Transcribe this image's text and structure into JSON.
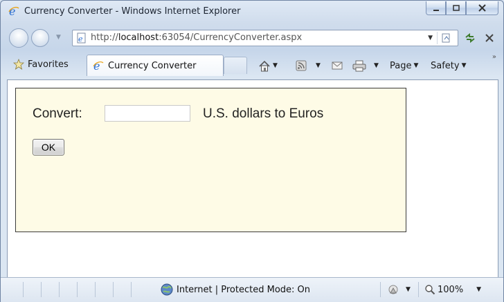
{
  "window": {
    "title": "Currency Converter - Windows Internet Explorer"
  },
  "navigation": {
    "url_host_prefix": "http://",
    "url_host": "localhost",
    "url_rest": ":63054/CurrencyConverter.aspx"
  },
  "commandbar": {
    "favorites_label": "Favorites",
    "tab_label": "Currency Converter",
    "page_label": "Page",
    "safety_label": "Safety"
  },
  "form": {
    "convert_label": "Convert:",
    "amount_value": "",
    "units_label": "U.S. dollars to Euros",
    "ok_label": "OK"
  },
  "statusbar": {
    "zone_text": "Internet | Protected Mode: On",
    "zoom_text": "100%"
  }
}
